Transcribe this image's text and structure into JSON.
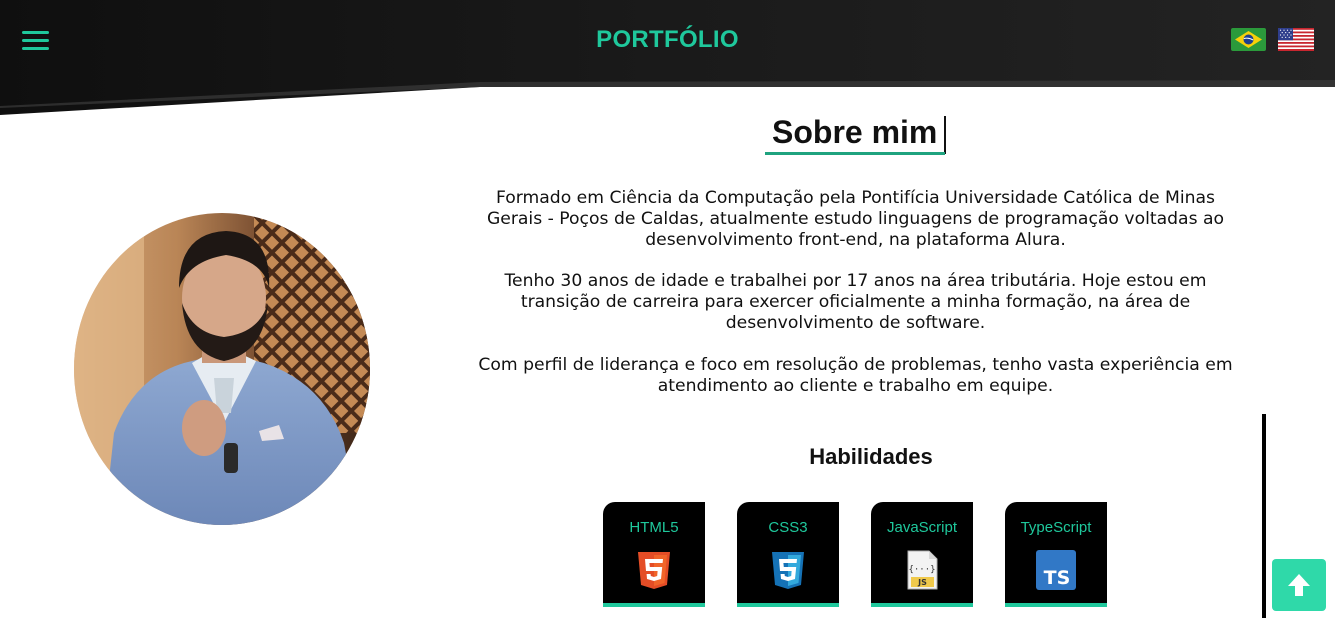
{
  "header": {
    "brand": "PORTFÓLIO",
    "menu_icon": "hamburger-menu-icon",
    "flags": [
      {
        "name": "brazil-flag-icon",
        "lang": "pt-BR"
      },
      {
        "name": "usa-flag-icon",
        "lang": "en-US"
      }
    ]
  },
  "about": {
    "title": "Sobre mim",
    "paragraphs": [
      "Formado em Ciência da Computação pela Pontifícia Universidade Católica de Minas Gerais - Poços de Caldas, atualmente estudo linguagens de programação voltadas ao desenvolvimento front-end, na plataforma Alura.",
      "Tenho 30 anos de idade e trabalhei por 17 anos na área tributária. Hoje estou em transição de carreira para exercer oficialmente a minha formação, na área de desenvolvimento de software.",
      "Com perfil de liderança e foco em resolução de problemas, tenho vasta experiência em atendimento ao cliente e trabalho em equipe."
    ]
  },
  "skills": {
    "title": "Habilidades",
    "items": [
      {
        "label": "HTML5",
        "icon": "html5-icon"
      },
      {
        "label": "CSS3",
        "icon": "css3-icon"
      },
      {
        "label": "JavaScript",
        "icon": "javascript-file-icon"
      },
      {
        "label": "TypeScript",
        "icon": "typescript-icon"
      }
    ]
  },
  "colors": {
    "accent": "#1fc89c",
    "header_bg": "#1c1c1c",
    "scroll_top_bg": "#2fd9a9"
  },
  "back_to_top_icon": "arrow-up-icon"
}
